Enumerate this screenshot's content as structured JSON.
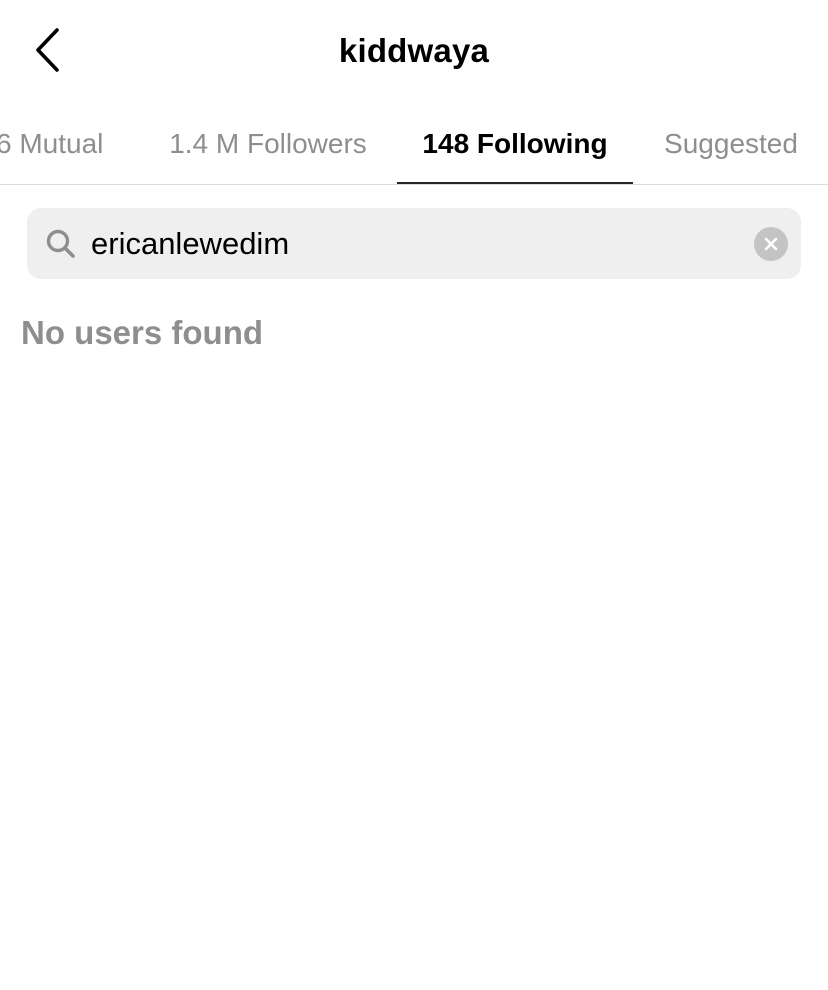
{
  "header": {
    "title": "kiddwaya",
    "back_icon": "chevron-left-icon"
  },
  "tabs": [
    {
      "label": "6 Mutual",
      "active": false
    },
    {
      "label": "1.4 M Followers",
      "active": false
    },
    {
      "label": "148 Following",
      "active": true
    },
    {
      "label": "Suggested",
      "active": false
    }
  ],
  "search": {
    "value": "ericanlewedim",
    "icon": "search-icon",
    "clear_icon": "clear-icon"
  },
  "results": {
    "empty_message": "No users found"
  },
  "colors": {
    "text_primary": "#000000",
    "text_secondary": "#8e8e8e",
    "search_background": "#efefef",
    "divider": "#dbdbdb"
  }
}
